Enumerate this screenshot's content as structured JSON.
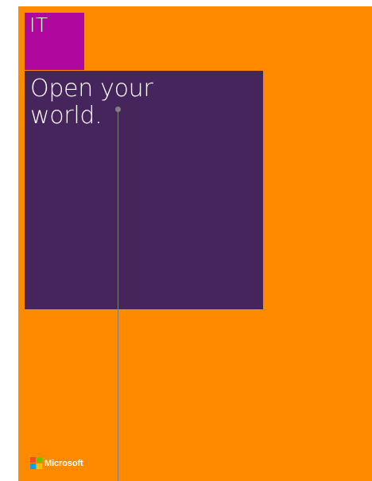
{
  "poster": {
    "tag": "IT",
    "headline_line1": "Open your",
    "headline_line2": "world.",
    "brand": "Microsoft"
  },
  "colors": {
    "background": "#ff8a00",
    "tag_tile": "#b0079f",
    "headline_tile": "#46245c",
    "pointer": "#808080",
    "text": "#ffffff"
  },
  "icons": {
    "brand_logo": "microsoft-logo-icon"
  }
}
